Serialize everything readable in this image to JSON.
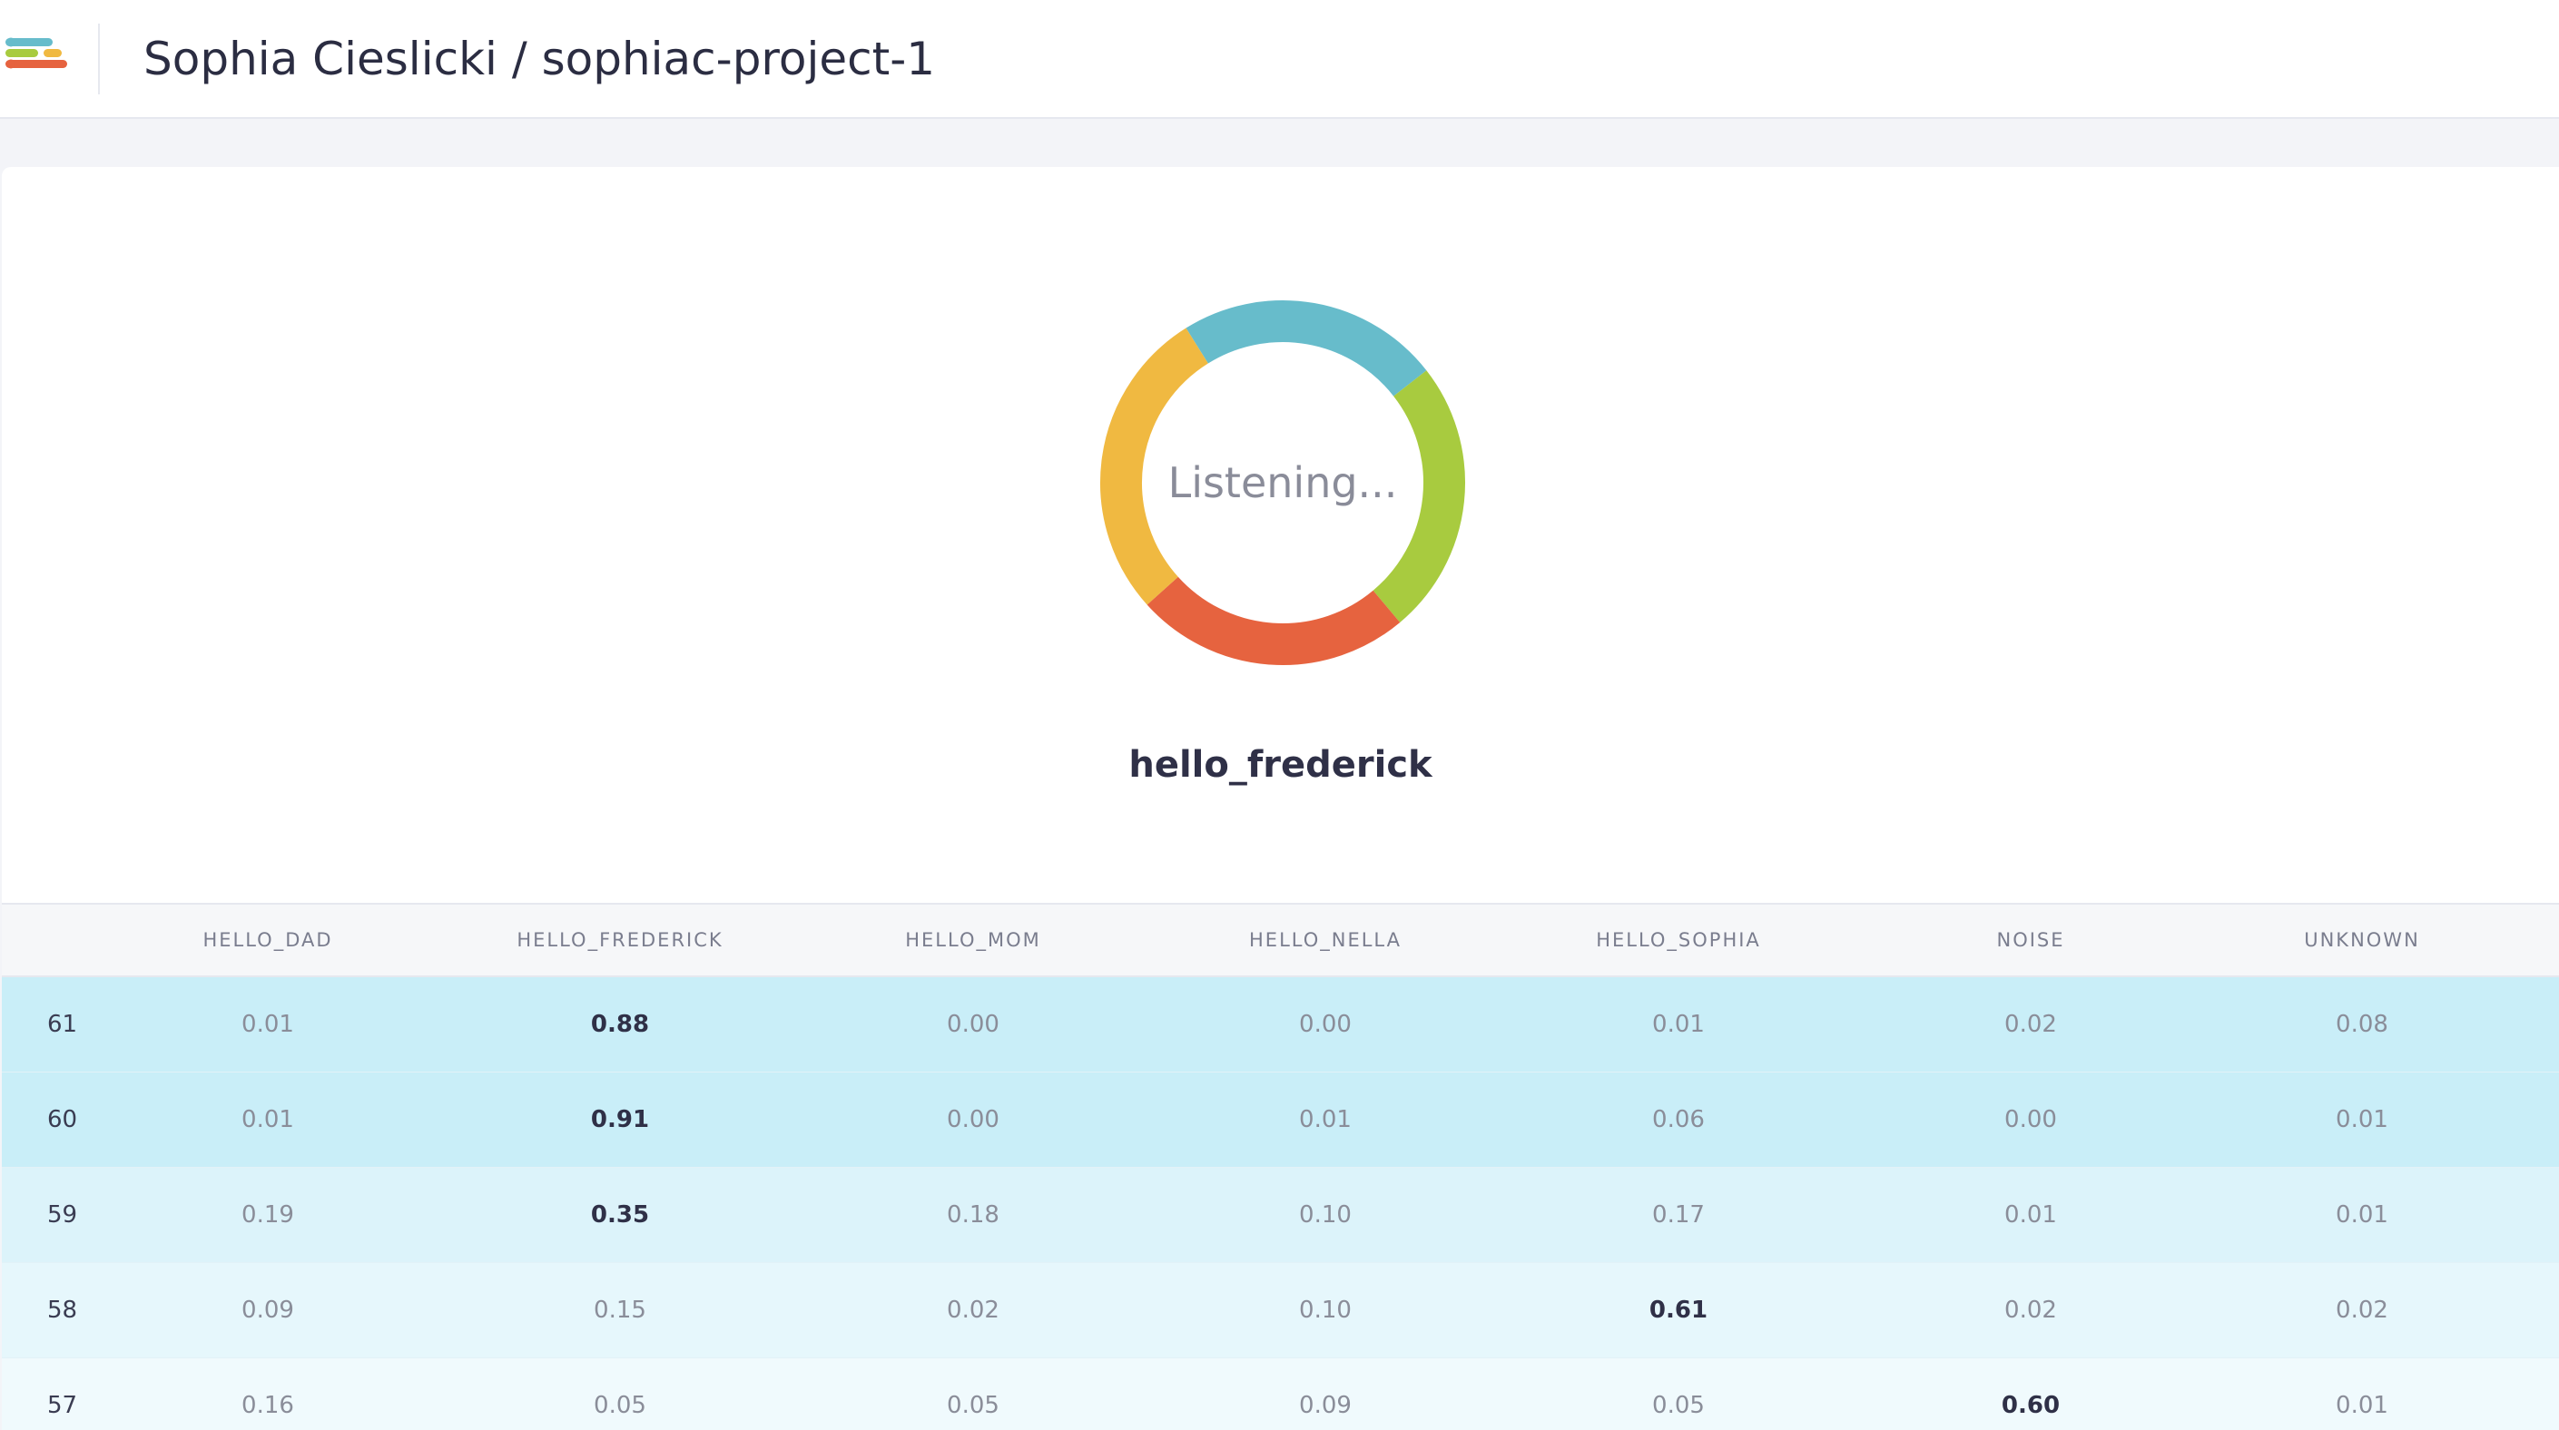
{
  "header": {
    "owner": "Sophia Cieslicki",
    "separator": " / ",
    "project": "sophiac-project-1",
    "logo_icon": "edge-impulse-logo-icon",
    "logo_colors": [
      "#67bccb",
      "#a8cb3f",
      "#f0b941",
      "#e6633f"
    ]
  },
  "classifier": {
    "status": "Listening...",
    "prediction": "hello_frederick",
    "ring_colors": [
      "#67bccb",
      "#a8cb3f",
      "#e6633f",
      "#f0b941"
    ]
  },
  "table": {
    "columns": [
      "",
      "HELLO_DAD",
      "HELLO_FREDERICK",
      "HELLO_MOM",
      "HELLO_NELLA",
      "HELLO_SOPHIA",
      "NOISE",
      "UNKNOWN"
    ],
    "rows": [
      {
        "id": "61",
        "values": [
          "0.01",
          "0.88",
          "0.00",
          "0.00",
          "0.01",
          "0.02",
          "0.08"
        ],
        "best": 1
      },
      {
        "id": "60",
        "values": [
          "0.01",
          "0.91",
          "0.00",
          "0.01",
          "0.06",
          "0.00",
          "0.01"
        ],
        "best": 1
      },
      {
        "id": "59",
        "values": [
          "0.19",
          "0.35",
          "0.18",
          "0.10",
          "0.17",
          "0.01",
          "0.01"
        ],
        "best": 1
      },
      {
        "id": "58",
        "values": [
          "0.09",
          "0.15",
          "0.02",
          "0.10",
          "0.61",
          "0.02",
          "0.02"
        ],
        "best": 4
      },
      {
        "id": "57",
        "values": [
          "0.16",
          "0.05",
          "0.05",
          "0.09",
          "0.05",
          "0.60",
          "0.01"
        ],
        "best": 5
      }
    ],
    "row_colors": [
      "#c9eef8",
      "#c9eef8",
      "#dcf3fa",
      "#e6f7fc",
      "#f0fafd"
    ]
  }
}
